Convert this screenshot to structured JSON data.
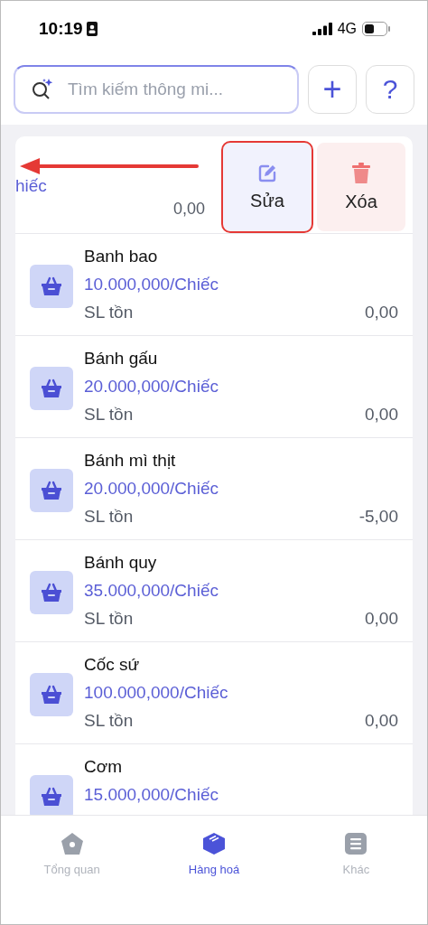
{
  "status_bar": {
    "time": "10:19",
    "network": "4G"
  },
  "search": {
    "placeholder": "Tìm kiếm thông mi..."
  },
  "header_buttons": [
    {
      "kind": "add",
      "glyph": "+"
    },
    {
      "kind": "help",
      "glyph": "?"
    }
  ],
  "swiped_item": {
    "price_fragment": "hiếc",
    "stock": "0,00",
    "actions": [
      {
        "kind": "edit",
        "label": "Sửa",
        "highlighted": true
      },
      {
        "kind": "delete",
        "label": "Xóa",
        "highlighted": false
      }
    ]
  },
  "products": [
    {
      "name": "Banh bao",
      "price": "10.000,000/Chiếc",
      "stock_label": "SL tồn",
      "stock": "0,00"
    },
    {
      "name": "Bánh gấu",
      "price": "20.000,000/Chiếc",
      "stock_label": "SL tồn",
      "stock": "0,00"
    },
    {
      "name": "Bánh mì thịt",
      "price": "20.000,000/Chiếc",
      "stock_label": "SL tồn",
      "stock": "-5,00"
    },
    {
      "name": "Bánh quy",
      "price": "35.000,000/Chiếc",
      "stock_label": "SL tồn",
      "stock": "0,00"
    },
    {
      "name": "Cốc sứ",
      "price": "100.000,000/Chiếc",
      "stock_label": "SL tồn",
      "stock": "0,00"
    },
    {
      "name": "Cơm",
      "price": "15.000,000/Chiếc"
    }
  ],
  "tab_bar": [
    {
      "kind": "home",
      "label": "Tổng quan",
      "selected": false
    },
    {
      "kind": "goods",
      "label": "Hàng hoá",
      "selected": true
    },
    {
      "kind": "more",
      "label": "Khác",
      "selected": false
    }
  ]
}
